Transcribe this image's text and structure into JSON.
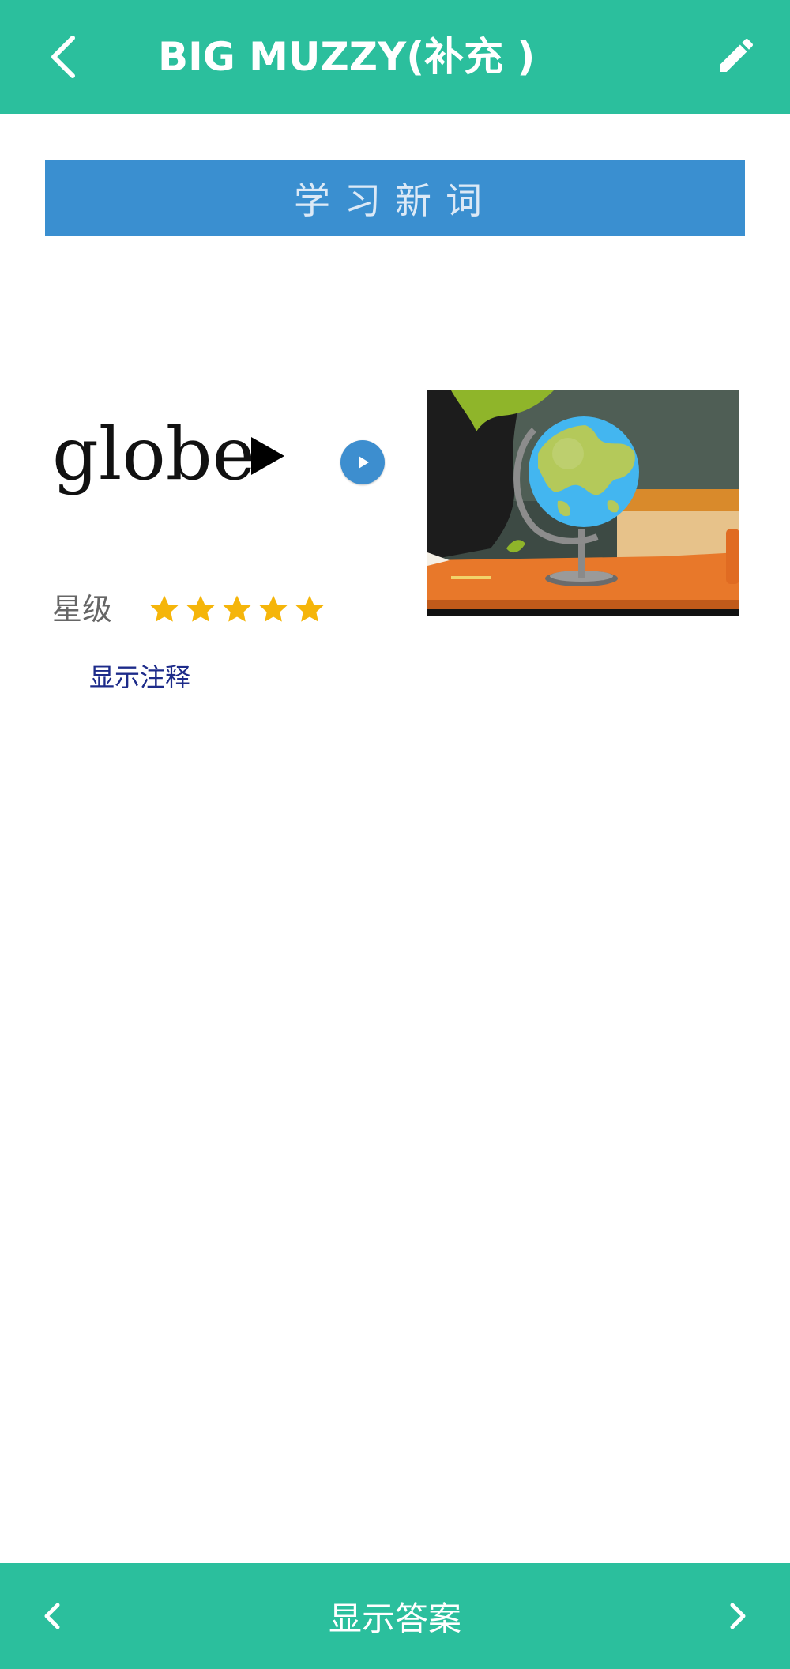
{
  "header": {
    "title": "BIG MUZZY(补充 )",
    "back_icon": "chevron-left-icon",
    "edit_icon": "pencil-icon",
    "color": "#2bbf9d"
  },
  "banner": {
    "label": "学习新词",
    "color": "#3a8fd0"
  },
  "word": {
    "text": "globe",
    "play_icon": "play-triangle-icon",
    "audio_icon": "audio-play-icon",
    "image": "globe-illustration"
  },
  "rating": {
    "label": "星级",
    "stars": 5,
    "max_stars": 5,
    "star_color": "#f5b50a"
  },
  "notes": {
    "label": "显示注释"
  },
  "footer": {
    "show_answer": "显示答案",
    "prev_icon": "chevron-left-icon",
    "next_icon": "chevron-right-icon",
    "color": "#2bbf9d"
  }
}
